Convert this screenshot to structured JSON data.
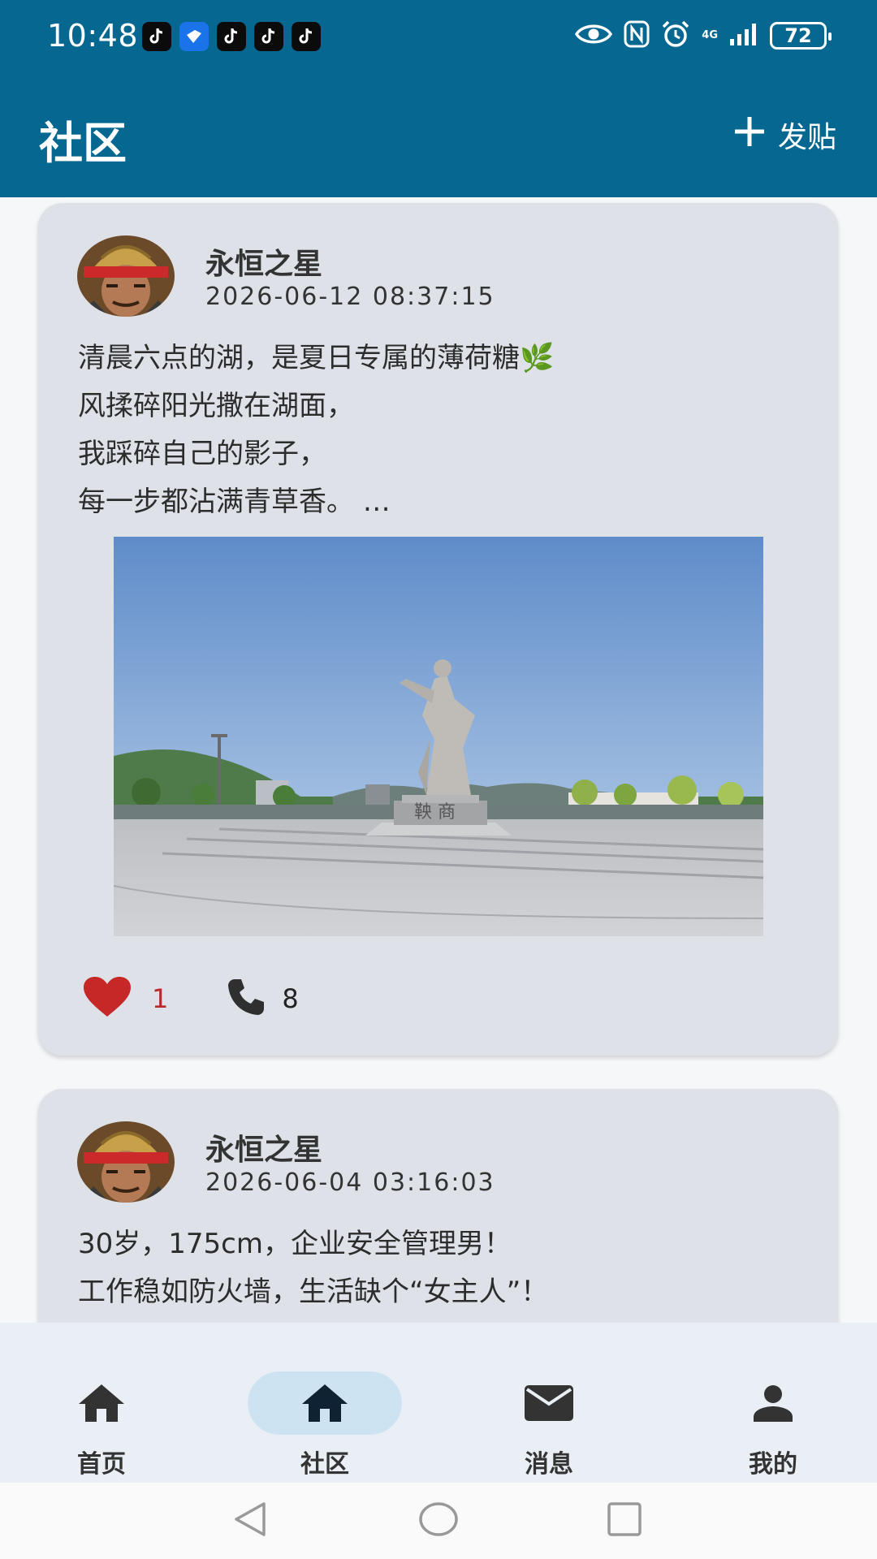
{
  "status_bar": {
    "time": "10:48",
    "network": "4G",
    "battery": "72"
  },
  "app_bar": {
    "title": "社区",
    "post_label": "发贴"
  },
  "posts": [
    {
      "author": "永恒之星",
      "time": "2026-06-12 08:37:15",
      "lines": [
        "清晨六点的湖，是夏日专属的薄荷糖🌿",
        "风揉碎阳光撒在湖面，",
        "我踩碎自己的影子，",
        "每一步都沾满青草香。 …"
      ],
      "likes": "1",
      "comments": "8"
    },
    {
      "author": "永恒之星",
      "time": "2026-06-04 03:16:03",
      "lines": [
        "30岁，175cm，企业安全管理男！",
        "工作稳如防火墙，生活缺个“女主人”！"
      ]
    }
  ],
  "bottom_nav": [
    {
      "label": "首页",
      "icon": "home-icon"
    },
    {
      "label": "社区",
      "icon": "home-icon",
      "active": true
    },
    {
      "label": "消息",
      "icon": "mail-icon"
    },
    {
      "label": "我的",
      "icon": "person-icon"
    }
  ],
  "colors": {
    "app_bar": "#066891",
    "card": "#dee2e8",
    "like": "#c62828",
    "nav_active_pill": "#cde3f2"
  }
}
